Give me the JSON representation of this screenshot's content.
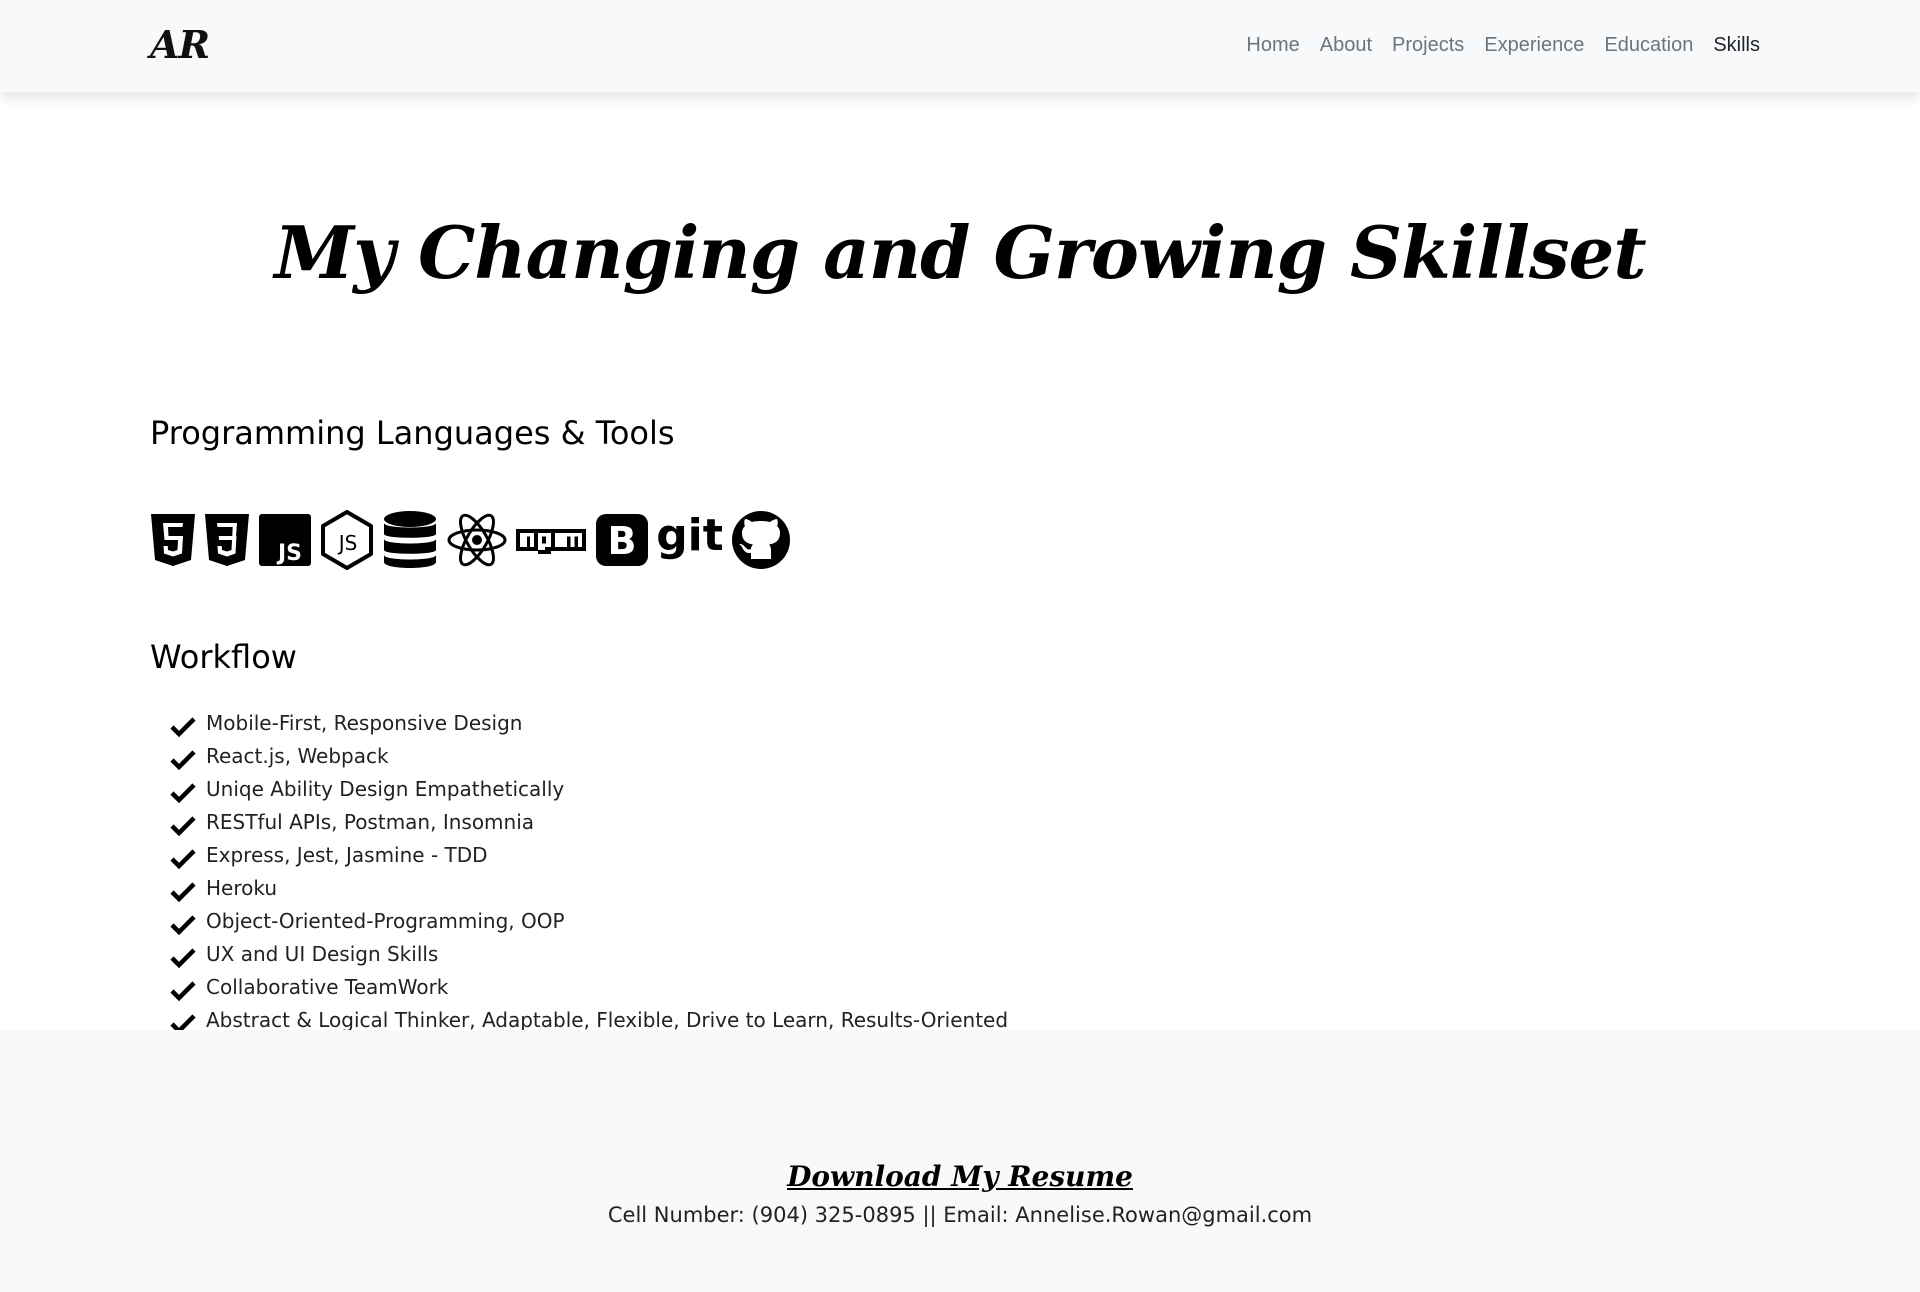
{
  "navbar": {
    "brand": "AR",
    "links": [
      "Home",
      "About",
      "Projects",
      "Experience",
      "Education",
      "Skills"
    ],
    "active": "Skills"
  },
  "page": {
    "title": "My Changing and Growing Skillset"
  },
  "tools": {
    "heading": "Programming Languages & Tools",
    "icons": [
      "html5-icon",
      "css3-icon",
      "javascript-icon",
      "nodejs-icon",
      "database-icon",
      "react-icon",
      "npm-icon",
      "bootstrap-icon",
      "git-icon",
      "github-icon"
    ],
    "git_text": "git"
  },
  "workflow": {
    "heading": "Workflow",
    "items": [
      "Mobile-First, Responsive Design",
      "React.js, Webpack",
      "Uniqe Ability Design Empathetically",
      "RESTful APIs, Postman, Insomnia",
      "Express, Jest, Jasmine - TDD",
      "Heroku",
      "Object-Oriented-Programming, OOP",
      "UX and UI Design Skills",
      "Collaborative TeamWork",
      "Abstract & Logical Thinker, Adaptable, Flexible, Drive to Learn, Results-Oriented"
    ]
  },
  "footer": {
    "resume_label": "Download My Resume",
    "contact": "Cell Number: (904) 325-0895 || Email: Annelise.Rowan@gmail.com"
  }
}
